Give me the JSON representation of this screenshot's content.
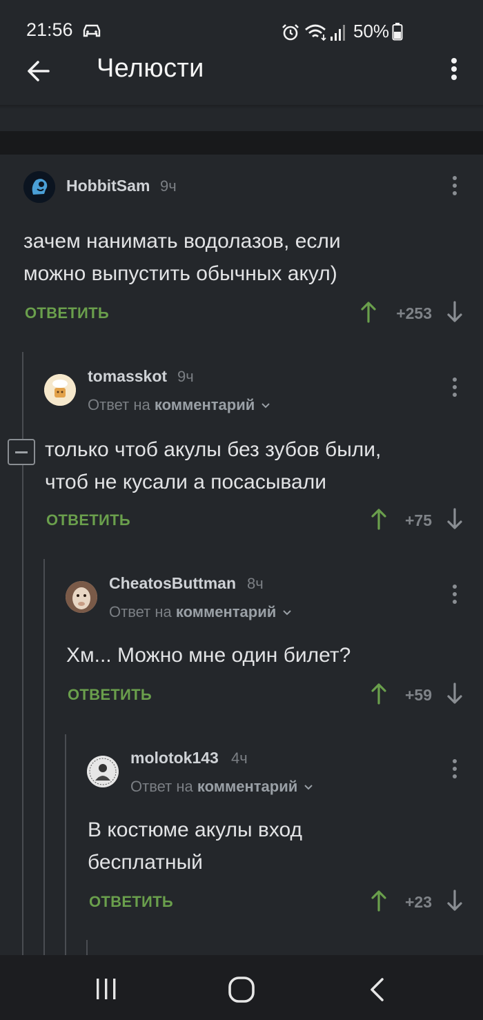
{
  "status": {
    "time": "21:56",
    "battery": "50%",
    "icons": [
      "car-icon",
      "alarm-icon",
      "wifi-icon",
      "signal-icon",
      "battery-icon"
    ]
  },
  "appbar": {
    "title": "Челюсти",
    "back_icon": "arrow-left-icon",
    "menu_icon": "more-vertical-icon"
  },
  "colors": {
    "background": "#24272b",
    "accent_green": "#6a9f4c",
    "text": "#e2e3e5",
    "muted": "#7b7f84"
  },
  "comments": [
    {
      "username": "HobbitSam",
      "time": "9ч",
      "reply_prefix": "",
      "reply_target": "",
      "body_line1": "зачем нанимать водолазов, если",
      "body_line2": "можно выпустить обычных акул)",
      "reply": "ОТВЕТИТЬ",
      "score": "+253"
    },
    {
      "username": "tomasskot",
      "time": "9ч",
      "reply_prefix": "Ответ на",
      "reply_target": "комментарий",
      "body_line1": "только чтоб акулы без зубов были,",
      "body_line2": "чтоб не кусали а посасывали",
      "reply": "ОТВЕТИТЬ",
      "score": "+75"
    },
    {
      "username": "CheatosButtman",
      "time": "8ч",
      "reply_prefix": "Ответ на",
      "reply_target": "комментарий",
      "body_line1": "Хм... Можно мне один билет?",
      "body_line2": "",
      "reply": "ОТВЕТИТЬ",
      "score": "+59"
    },
    {
      "username": "molotok143",
      "time": "4ч",
      "reply_prefix": "Ответ на",
      "reply_target": "комментарий",
      "body_line1": "В костюме акулы вход",
      "body_line2": "бесплатный",
      "reply": "ОТВЕТИТЬ",
      "score": "+23"
    }
  ]
}
